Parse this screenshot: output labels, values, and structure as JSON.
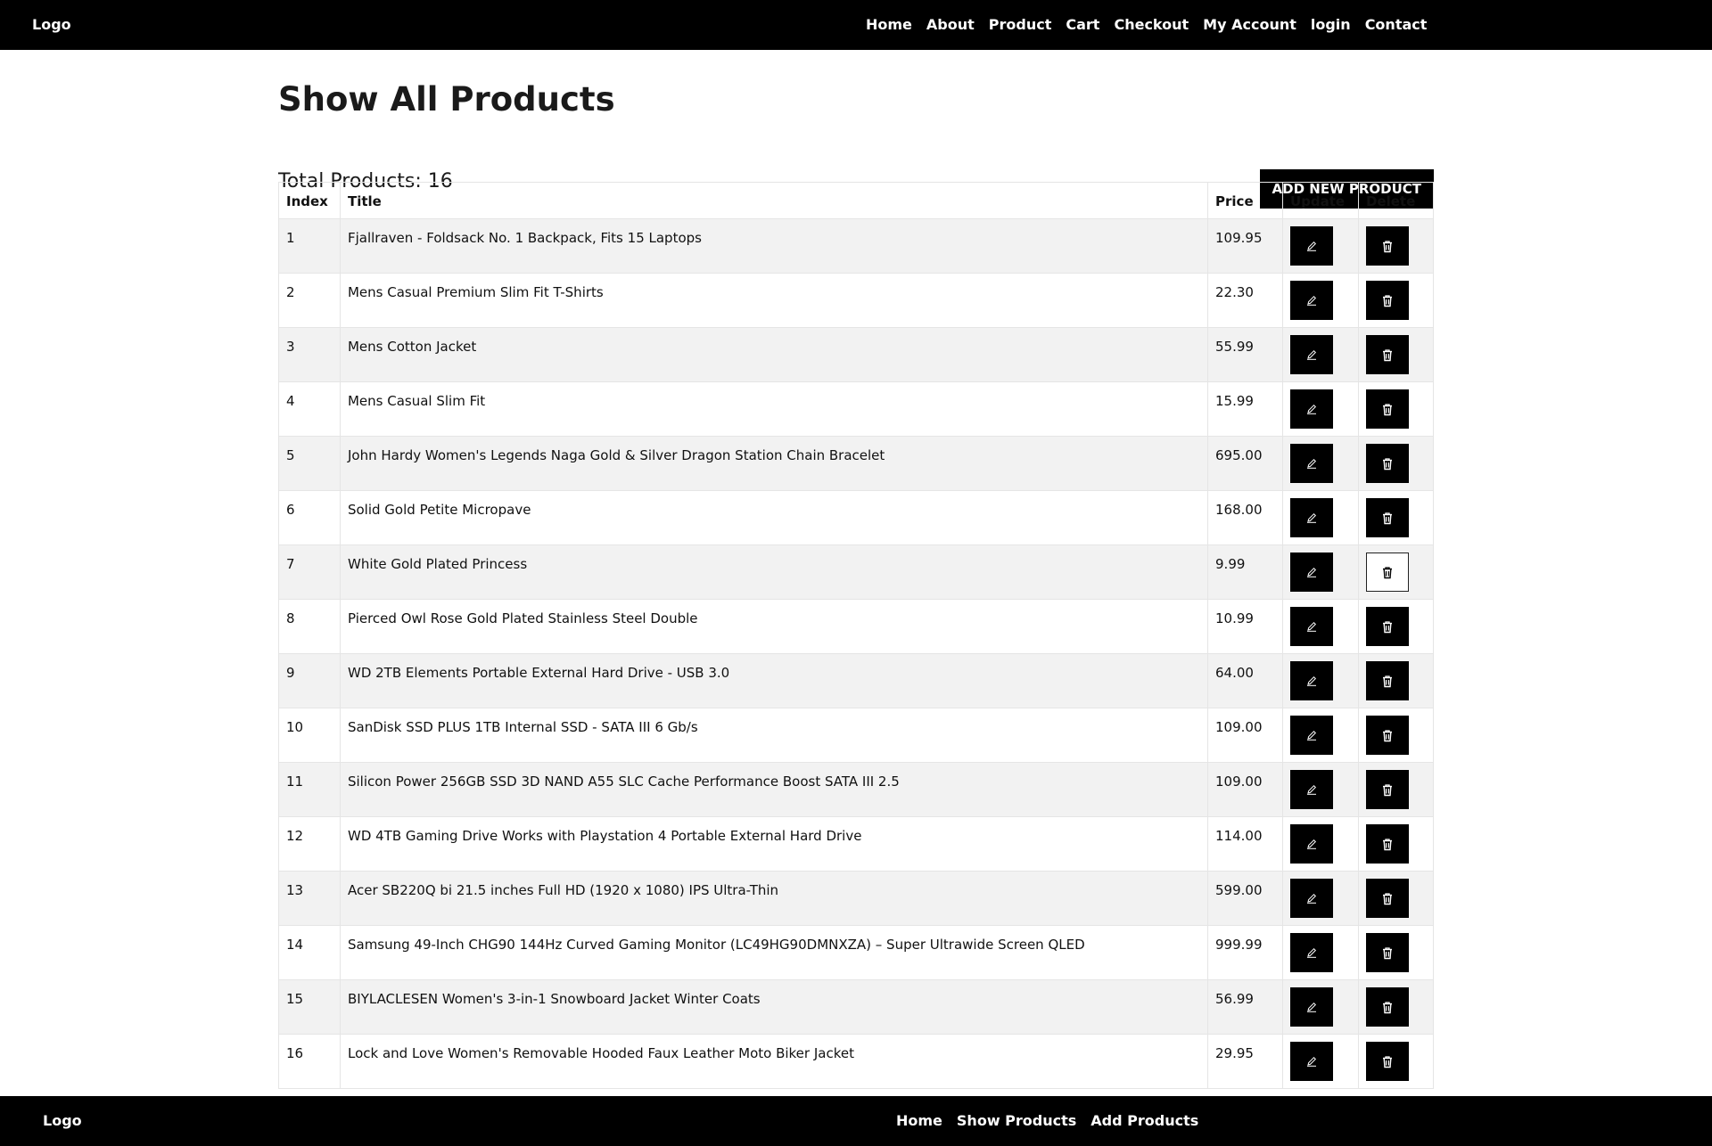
{
  "header": {
    "logo": "Logo",
    "nav": [
      "Home",
      "About",
      "Product",
      "Cart",
      "Checkout",
      "My Account",
      "login",
      "Contact"
    ]
  },
  "main": {
    "title": "Show All Products",
    "total_label": "Total Products: 16",
    "add_button": "ADD NEW PRODUCT",
    "columns": [
      "Index",
      "Title",
      "Price",
      "Update",
      "Delete"
    ],
    "rows": [
      {
        "index": "1",
        "title": "Fjallraven - Foldsack No. 1 Backpack, Fits 15 Laptops",
        "price": "109.95"
      },
      {
        "index": "2",
        "title": "Mens Casual Premium Slim Fit T-Shirts",
        "price": "22.30"
      },
      {
        "index": "3",
        "title": "Mens Cotton Jacket",
        "price": "55.99"
      },
      {
        "index": "4",
        "title": "Mens Casual Slim Fit",
        "price": "15.99"
      },
      {
        "index": "5",
        "title": "John Hardy Women's Legends Naga Gold & Silver Dragon Station Chain Bracelet",
        "price": "695.00"
      },
      {
        "index": "6",
        "title": "Solid Gold Petite Micropave",
        "price": "168.00"
      },
      {
        "index": "7",
        "title": "White Gold Plated Princess",
        "price": "9.99"
      },
      {
        "index": "8",
        "title": "Pierced Owl Rose Gold Plated Stainless Steel Double",
        "price": "10.99"
      },
      {
        "index": "9",
        "title": "WD 2TB Elements Portable External Hard Drive - USB 3.0",
        "price": "64.00"
      },
      {
        "index": "10",
        "title": "SanDisk SSD PLUS 1TB Internal SSD - SATA III 6 Gb/s",
        "price": "109.00"
      },
      {
        "index": "11",
        "title": "Silicon Power 256GB SSD 3D NAND A55 SLC Cache Performance Boost SATA III 2.5",
        "price": "109.00"
      },
      {
        "index": "12",
        "title": "WD 4TB Gaming Drive Works with Playstation 4 Portable External Hard Drive",
        "price": "114.00"
      },
      {
        "index": "13",
        "title": "Acer SB220Q bi 21.5 inches Full HD (1920 x 1080) IPS Ultra-Thin",
        "price": "599.00"
      },
      {
        "index": "14",
        "title": "Samsung 49-Inch CHG90 144Hz Curved Gaming Monitor (LC49HG90DMNXZA) – Super Ultrawide Screen QLED",
        "price": "999.99"
      },
      {
        "index": "15",
        "title": "BIYLACLESEN Women's 3-in-1 Snowboard Jacket Winter Coats",
        "price": "56.99"
      },
      {
        "index": "16",
        "title": "Lock and Love Women's Removable Hooded Faux Leather Moto Biker Jacket",
        "price": "29.95"
      }
    ],
    "update_icon": "pencil-icon",
    "delete_icon": "trash-icon",
    "hovered_delete_row": 7
  },
  "footer": {
    "logo": "Logo",
    "nav": [
      "Home",
      "Show Products",
      "Add Products"
    ]
  }
}
